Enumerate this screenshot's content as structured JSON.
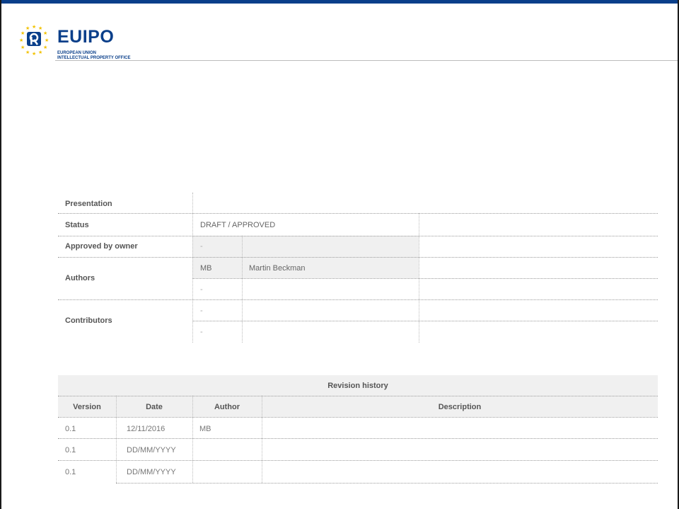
{
  "brand": {
    "wordmark": "EUIPO",
    "subtitle_line1": "EUROPEAN UNION",
    "subtitle_line2": "INTELLECTUAL PROPERTY OFFICE",
    "color": "#0a3f8a",
    "star_color": "#f2c200"
  },
  "info": {
    "presentation": "Presentation",
    "status_label": "Status",
    "status_value": "DRAFT / APPROVED",
    "approved_label": "Approved by owner",
    "approved_value": "-",
    "authors_label": "Authors",
    "author1_initials": "MB",
    "author1_name": "Martin Beckman",
    "author2_initials": "-",
    "contributors_label": "Contributors",
    "contributor1": "-",
    "contributor2": "-"
  },
  "revision": {
    "title": "Revision history",
    "headers": [
      "Version",
      "Date",
      "Author",
      "Description"
    ],
    "rows": [
      {
        "version": "0.1",
        "date": "12/11/2016",
        "author": "MB",
        "description": ""
      },
      {
        "version": "0.1",
        "date": "DD/MM/YYYY",
        "author": "",
        "description": ""
      },
      {
        "version": "0.1",
        "date": "DD/MM/YYYY",
        "author": "",
        "description": ""
      }
    ]
  }
}
